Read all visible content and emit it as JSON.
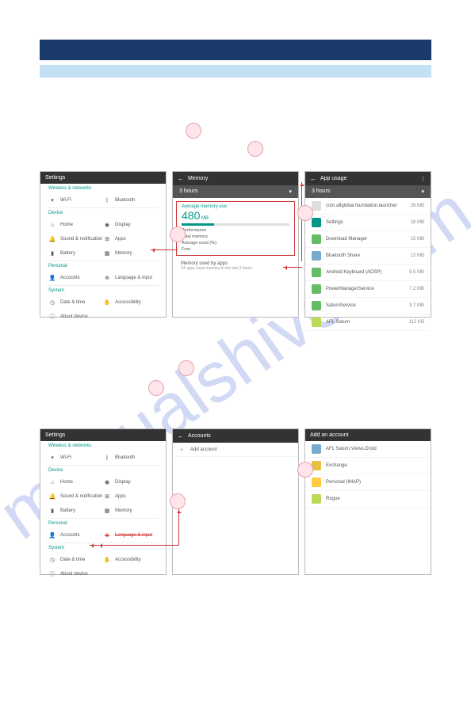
{
  "settings_title": "Settings",
  "sec_wireless": "Wireless & networks",
  "sec_device": "Device",
  "sec_personal": "Personal",
  "sec_system": "System",
  "wifi": "Wi-Fi",
  "bluetooth": "Bluetooth",
  "home_label": "Home",
  "display": "Display",
  "sound": "Sound & notification",
  "apps": "Apps",
  "battery": "Battery",
  "memory": "Memory",
  "accounts": "Accounts",
  "language": "Language & input",
  "datetime": "Date & time",
  "accessibility": "Accessibility",
  "about": "About device",
  "mem_title": "Memory",
  "time_range": "3 hours",
  "avg_use": "Average memory use",
  "mem_value": "480",
  "mem_unit": "MB",
  "perf": "Performance",
  "total": "Total memory",
  "avg_used_pc": "Average used (%)",
  "free": "Free",
  "mem_apps": "Memory used by apps",
  "mem_apps_sub": "14 apps used memory in the last 3 hours",
  "app_usage": "App usage",
  "u0_name": "com.aflglobal.foundation.launcher",
  "u0_size": "28 MB",
  "u1_name": "Settings",
  "u1_size": "18 MB",
  "u2_name": "Download Manager",
  "u2_size": "15 MB",
  "u3_name": "Bluetooth Share",
  "u3_size": "12 MB",
  "u4_name": "Android Keyboard (AOSP)",
  "u4_size": "9.5 MB",
  "u5_name": "PowerManagerService",
  "u5_size": "7.2 MB",
  "u6_name": "SaturnService",
  "u6_size": "3.7 MB",
  "u7_name": "AFL Saturn",
  "u7_size": "112 KB",
  "accounts_title": "Accounts",
  "add_account": "Add account",
  "add_an_account": "Add an account",
  "acct0": "AFL Saturn.Views.Droid",
  "acct1": "Exchange",
  "acct2": "Personal (IMAP)",
  "acct3": "Rogue"
}
